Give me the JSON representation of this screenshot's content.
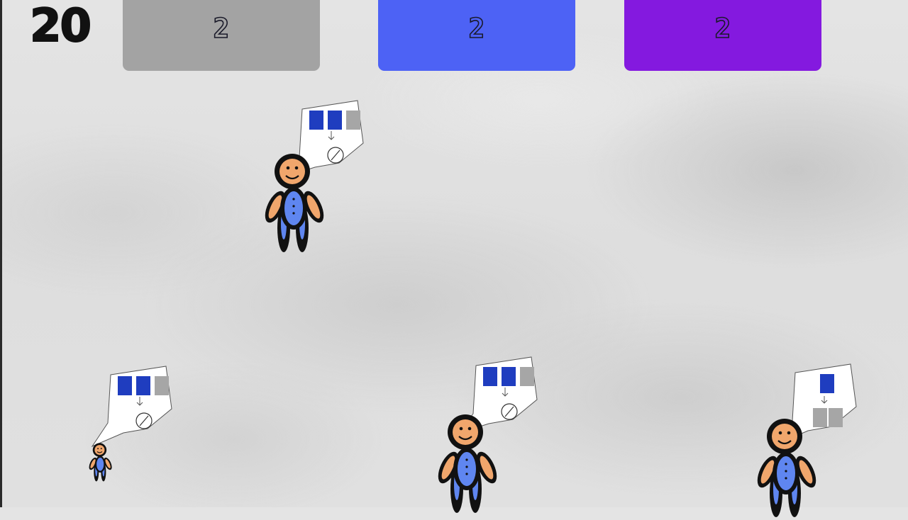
{
  "hud": {
    "score": "20",
    "panels": [
      {
        "label": "2",
        "color": "#a3a3a3"
      },
      {
        "label": "2",
        "color": "#4d62f5"
      },
      {
        "label": "2",
        "color": "#8419df"
      }
    ]
  },
  "colors": {
    "block_blue": "#1f3dbf",
    "block_gray": "#a6a6a6",
    "skin": "#f0a66c",
    "shirt": "#5f86f0",
    "outline": "#111111"
  },
  "characters": [
    {
      "id": "person-1",
      "order_top": [
        "blue",
        "blue",
        "gray"
      ],
      "order_bottom": "none-icon"
    },
    {
      "id": "person-2",
      "order_top": [
        "blue",
        "blue",
        "gray"
      ],
      "order_bottom": "none-icon"
    },
    {
      "id": "person-3",
      "order_top": [
        "blue",
        "blue",
        "gray"
      ],
      "order_bottom": "none-icon"
    },
    {
      "id": "person-4",
      "order_top": [
        "blue"
      ],
      "order_bottom": [
        "gray",
        "gray"
      ]
    }
  ]
}
